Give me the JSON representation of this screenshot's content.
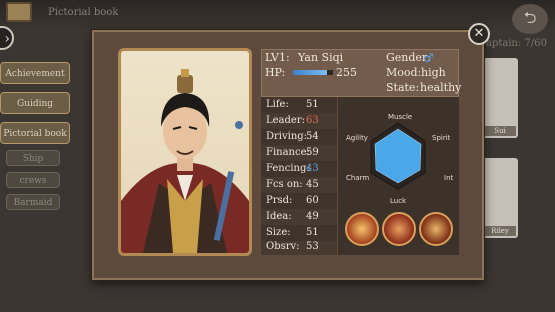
{
  "header": {
    "title": "Pictorial book",
    "captain_text": "aptain: 7/60"
  },
  "sidebar": {
    "items": [
      "Achievement",
      "Guiding",
      "Pictorial book",
      "Ship",
      "crews",
      "Barmaid"
    ]
  },
  "background_cards": [
    "Sui",
    "Riley"
  ],
  "character": {
    "level_label": "LV1:",
    "name": "Yan Siqi",
    "gender_label": "Gender:",
    "gender_symbol": "♂",
    "hp_label": "HP:",
    "hp_value": "255",
    "hp_fill_fraction": 0.85,
    "mood_label": "Mood:",
    "mood_value": "high",
    "state_label": "State:",
    "state_value": "healthy"
  },
  "stats": [
    {
      "label": "Life:",
      "value": "51",
      "color": "#efe6d8"
    },
    {
      "label": "Leader:",
      "value": "63",
      "color": "#e06a52"
    },
    {
      "label": "Driving:",
      "value": "54",
      "color": "#efe6d8"
    },
    {
      "label": "Finance:",
      "value": "59",
      "color": "#efe6d8"
    },
    {
      "label": "Fencing:",
      "value": "43",
      "color": "#5ea6e6"
    },
    {
      "label": "Fcs on:",
      "value": "45",
      "color": "#efe6d8"
    },
    {
      "label": "Prsd:",
      "value": "60",
      "color": "#efe6d8"
    },
    {
      "label": "Idea:",
      "value": "49",
      "color": "#efe6d8"
    },
    {
      "label": "Size:",
      "value": "51",
      "color": "#efe6d8"
    },
    {
      "label": "Obsrv:",
      "value": "53",
      "color": "#efe6d8"
    }
  ],
  "radar": {
    "labels": [
      "Muscle",
      "Spirit",
      "Int",
      "Luck",
      "Charm",
      "Agility"
    ],
    "fill_color": "#4aa8e8"
  },
  "skills": [
    "fire-slash-skill-icon",
    "flame-fist-skill-icon",
    "rising-flame-skill-icon"
  ],
  "close_symbol": "✕"
}
